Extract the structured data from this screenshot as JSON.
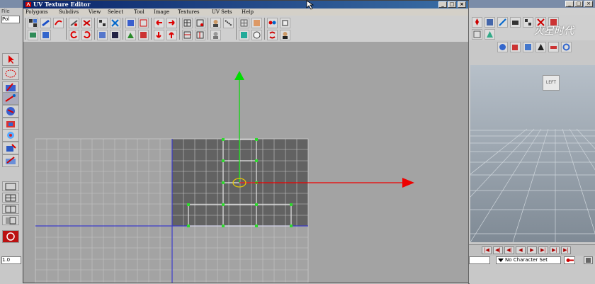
{
  "window": {
    "title": "UV Texture Editor",
    "controls": [
      "_",
      "□",
      "×"
    ]
  },
  "menubar": [
    "Polygons",
    "Subdivs",
    "View",
    "Select",
    "Tool",
    "Image",
    "Textures",
    "UV Sets",
    "Help"
  ],
  "host": {
    "menu_fragment": "File",
    "field_fragment": "Pol",
    "value_field": "1.0",
    "watermark": "火星时代"
  },
  "viewport": {
    "view_cube_label": "LEFT"
  },
  "anim_controls": [
    "|◀",
    "◀|",
    "◀",
    "▶",
    "▶|",
    "▶|"
  ],
  "character_set": {
    "label": "No Character Set"
  },
  "colors": {
    "uv_background": "#a3a3a3",
    "uv_tile": "#626262",
    "grid_line": "#c5c5c5",
    "axis_blue": "#3d3dcc",
    "manip_green": "#00dd00",
    "manip_red": "#ee0000",
    "pivot_yellow": "#e8c800",
    "titlebar": "#0a246a"
  },
  "icons": {
    "toolbar": [
      "checker-icon",
      "move-uv-icon",
      "rotate-uv-icon",
      "flip-u-icon",
      "flip-v-icon",
      "rotate-cw-icon",
      "rotate-ccw-icon",
      "cut-uv-icon",
      "sew-uv-icon",
      "layout-icon",
      "unfold-icon",
      "grid-uv-icon",
      "align-min-u-icon",
      "align-max-u-icon",
      "align-min-v-icon",
      "align-max-v-icon",
      "snapshot-icon",
      "display-image-icon",
      "dim-image-icon",
      "shaded-icon",
      "texture-borders-icon",
      "pixel-snap-icon",
      "color-channels-icon",
      "image-range-icon"
    ]
  }
}
